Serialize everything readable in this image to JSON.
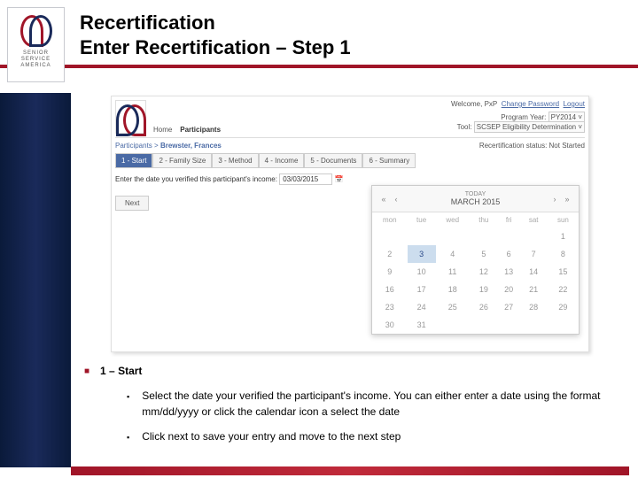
{
  "logo": {
    "l1": "SENIOR",
    "l2": "SERVICE",
    "l3": "AMERICA"
  },
  "title": {
    "l1": "Recertification",
    "l2": "Enter Recertification – Step 1"
  },
  "screenshot": {
    "nav": {
      "home": "Home",
      "participants": "Participants"
    },
    "welcome": "Welcome, PxP",
    "links": {
      "change_pw": "Change Password",
      "logout": "Logout"
    },
    "program_year_label": "Program Year:",
    "program_year_value": "PY2014",
    "tool_label": "Tool:",
    "tool_value": "SCSEP Eligibility Determination",
    "breadcrumb": {
      "root": "Participants",
      "sep": ">",
      "name": "Brewster, Frances"
    },
    "status_label": "Recertification status:",
    "status_value": "Not Started",
    "tabs": [
      "1 - Start",
      "2 - Family Size",
      "3 - Method",
      "4 - Income",
      "5 - Documents",
      "6 - Summary"
    ],
    "instruction": "Enter the date you verified this participant's income:",
    "date_value": "03/03/2015",
    "next": "Next"
  },
  "calendar": {
    "today": "TODAY",
    "month": "MARCH 2015",
    "weekdays": [
      "mon",
      "tue",
      "wed",
      "thu",
      "fri",
      "sat",
      "sun"
    ],
    "rows": [
      [
        "",
        "",
        "",
        "",
        "",
        "",
        "1"
      ],
      [
        "2",
        "3",
        "4",
        "5",
        "6",
        "7",
        "8"
      ],
      [
        "9",
        "10",
        "11",
        "12",
        "13",
        "14",
        "15"
      ],
      [
        "16",
        "17",
        "18",
        "19",
        "20",
        "21",
        "22"
      ],
      [
        "23",
        "24",
        "25",
        "26",
        "27",
        "28",
        "29"
      ],
      [
        "30",
        "31",
        "",
        "",
        "",
        "",
        ""
      ]
    ],
    "selected": "3"
  },
  "notes": {
    "heading": "1 – Start",
    "b1": "Select the date your verified the participant's income.  You can either enter a date using the format mm/dd/yyyy or click the calendar icon a select the date",
    "b2": "Click next to save your entry and move to the next step"
  }
}
